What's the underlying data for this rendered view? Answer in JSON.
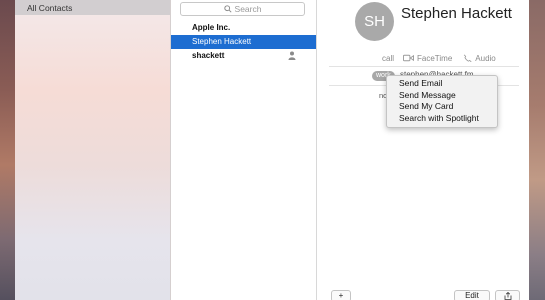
{
  "sidebar": {
    "items": [
      {
        "label": "All Contacts",
        "selected": true
      }
    ]
  },
  "list": {
    "search_placeholder": "Search",
    "contacts": [
      {
        "label": "Apple Inc.",
        "selected": false
      },
      {
        "label": "Stephen Hackett",
        "selected": true
      },
      {
        "label": "shackett",
        "selected": false,
        "icon": "person-icon"
      }
    ]
  },
  "detail": {
    "initials": "SH",
    "name": "Stephen Hackett",
    "actions": {
      "call": "call",
      "facetime": "FaceTime",
      "audio": "Audio"
    },
    "email_label": "work",
    "email_value": "stephen@hackett.fm",
    "note_fragment": "no"
  },
  "context_menu": {
    "items": [
      "Send Email",
      "Send Message",
      "Send My Card",
      "Search with Spotlight"
    ]
  },
  "toolbar": {
    "add_label": "+",
    "edit_label": "Edit",
    "share_icon": "share-icon"
  },
  "colors": {
    "selection": "#1d6dd1",
    "avatar": "#a9a9a9"
  }
}
